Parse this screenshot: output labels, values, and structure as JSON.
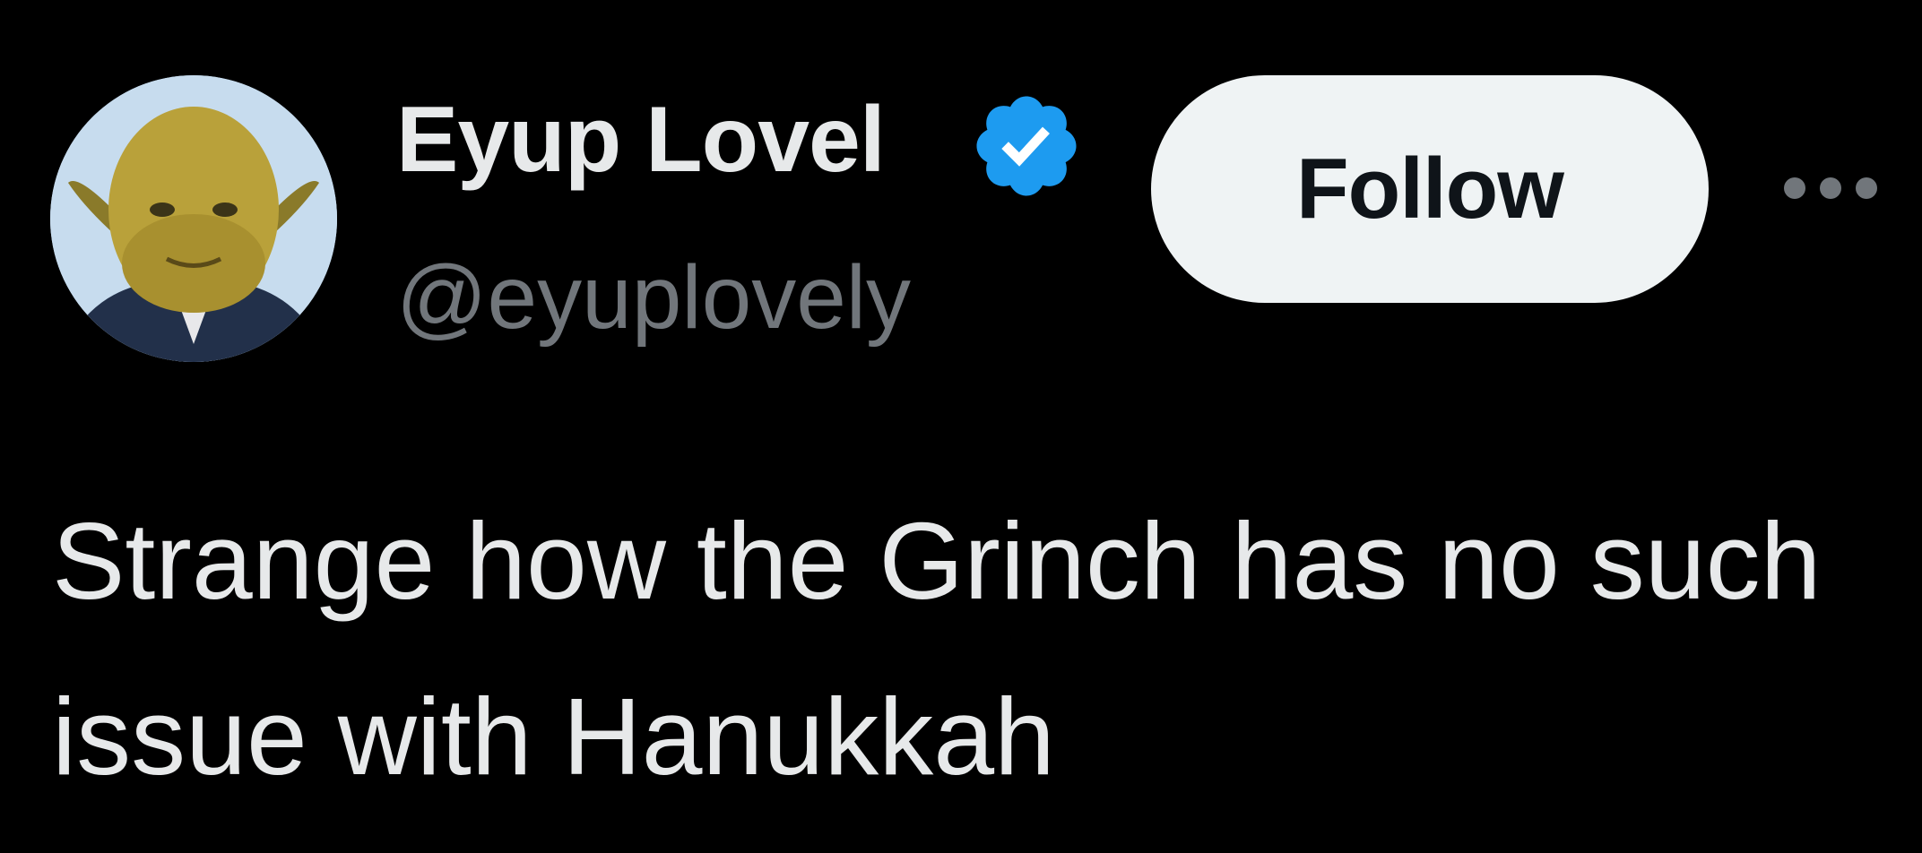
{
  "tweet": {
    "author": {
      "display_name": "Eyup Lovel",
      "handle": "@eyuplovely",
      "verified": true,
      "verified_icon": "verified-badge-icon",
      "verified_color": "#1d9bf0"
    },
    "follow_label": "Follow",
    "more_icon": "more-options-icon",
    "text": "Strange how the Grinch has no such issue with Hanukkah"
  },
  "colors": {
    "background": "#000000",
    "primary_text": "#e7e9ea",
    "secondary_text": "#71767b",
    "follow_bg": "#eff3f4",
    "follow_text": "#0f1419",
    "accent": "#1d9bf0"
  }
}
